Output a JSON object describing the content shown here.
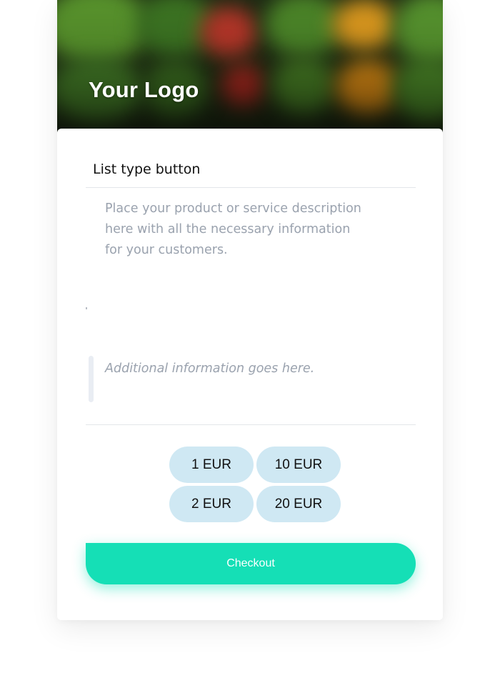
{
  "header": {
    "logo_text": "Your Logo"
  },
  "product": {
    "title": "List type button",
    "description": "Place your product or service description\nhere with all the necessary information\nfor your customers.",
    "additional_info": "Additional information goes here."
  },
  "amounts": [
    {
      "label": "1 EUR"
    },
    {
      "label": "10 EUR"
    },
    {
      "label": "2 EUR"
    },
    {
      "label": "20 EUR"
    }
  ],
  "checkout": {
    "label": "Checkout"
  },
  "colors": {
    "accent": "#15dfb6",
    "amount_button_bg": "#cfe8f3",
    "muted_text": "#9aa2ae"
  }
}
